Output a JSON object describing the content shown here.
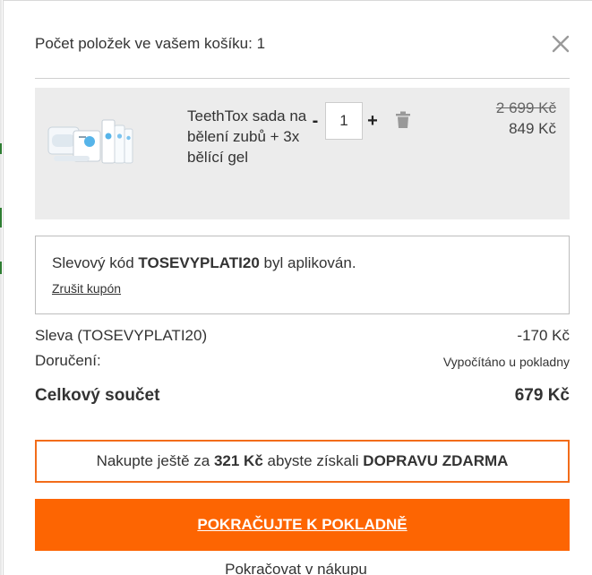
{
  "cart": {
    "header": "Počet položek ve vašem košíku: 1"
  },
  "item": {
    "name": "TeethTox sada na bělení zubů + 3x bělící gel",
    "quantity": "1",
    "qty_minus": "-",
    "qty_plus": "+",
    "price_old": "2 699 Kč",
    "price_new": "849 Kč"
  },
  "coupon": {
    "prefix": "Slevový kód ",
    "code": "TOSEVYPLATI20",
    "suffix": " byl aplikován.",
    "remove_label": "Zrušit kupón"
  },
  "summary": {
    "discount_label": "Sleva (TOSEVYPLATI20)",
    "discount_value": "-170 Kč",
    "delivery_label": "Doručení:",
    "delivery_value": "Vypočítáno u pokladny",
    "total_label": "Celkový součet",
    "total_value": "679 Kč"
  },
  "free_shipping": {
    "prefix": "Nakupte ještě za ",
    "amount": "321 Kč",
    "middle": " abyste získali ",
    "highlight": "DOPRAVU ZDARMA"
  },
  "actions": {
    "checkout_label": "POKRAČUJTE K POKLADNĚ",
    "continue_label": "Pokračovat v nákupu"
  },
  "icons": {
    "close": "close-icon",
    "trash": "trash-icon"
  },
  "colors": {
    "accent": "#fd6502",
    "item_bg": "#ececec",
    "free_ship_border": "#f26c1a"
  }
}
